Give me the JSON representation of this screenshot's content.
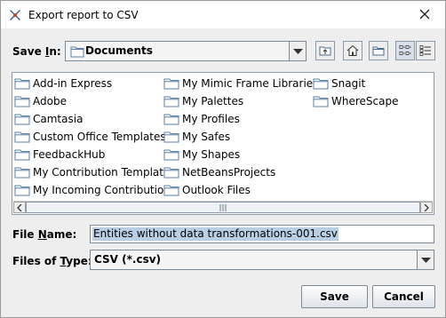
{
  "window": {
    "title": "Export report to CSV"
  },
  "save_in": {
    "label_prefix": "Save ",
    "label_mnemonic": "I",
    "label_suffix": "n:",
    "value": "Documents"
  },
  "toolbar": {
    "buttons": [
      {
        "icon": "up-one-level-icon"
      },
      {
        "icon": "home-icon"
      },
      {
        "icon": "new-folder-icon"
      },
      {
        "icon": "list-view-icon",
        "selected": true
      },
      {
        "icon": "details-view-icon"
      }
    ]
  },
  "files": [
    "Add-in Express",
    "Adobe",
    "Camtasia",
    "Custom Office Templates",
    "FeedbackHub",
    "My Contribution Templates",
    "My Incoming Contributions",
    "My Mimic Frame Libraries",
    "My Palettes",
    "My Profiles",
    "My Safes",
    "My Shapes",
    "NetBeansProjects",
    "Outlook Files",
    "Snagit",
    "WhereScape"
  ],
  "file_name": {
    "label_prefix": "File ",
    "label_mnemonic": "N",
    "label_suffix": "ame:",
    "value": "Entities without data transformations-001.csv"
  },
  "file_type": {
    "label_prefix": "Files of ",
    "label_mnemonic": "T",
    "label_suffix": "ype:",
    "value": "CSV (*.csv)"
  },
  "actions": {
    "save_label": "Save",
    "cancel_label": "Cancel"
  },
  "colors": {
    "selection": "#b8cfe5",
    "border": "#7a8a99",
    "folder": "#5a7fa8"
  }
}
